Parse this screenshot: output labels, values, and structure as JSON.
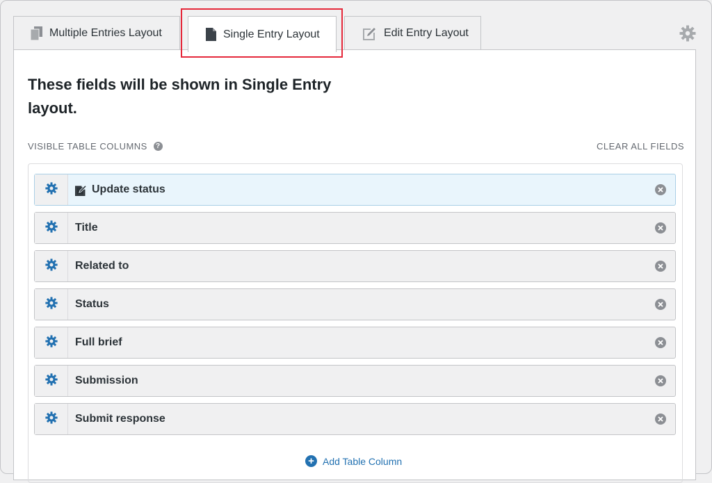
{
  "tabs": [
    {
      "label": "Multiple Entries Layout",
      "icon": "documents-icon"
    },
    {
      "label": "Single Entry Layout",
      "icon": "document-icon"
    },
    {
      "label": "Edit Entry Layout",
      "icon": "edit-document-icon"
    }
  ],
  "active_tab": "Single Entry Layout",
  "heading": "These fields will be shown in Single Entry layout.",
  "section": {
    "label": "VISIBLE TABLE COLUMNS",
    "help_icon": "?",
    "clear_all": "CLEAR ALL FIELDS"
  },
  "fields": [
    {
      "label": "Update status",
      "icon": "edit-icon",
      "highlighted": true
    },
    {
      "label": "Title"
    },
    {
      "label": "Related to"
    },
    {
      "label": "Status"
    },
    {
      "label": "Full brief"
    },
    {
      "label": "Submission"
    },
    {
      "label": "Submit response"
    }
  ],
  "add_column": {
    "label": "Add Table Column",
    "icon": "plus-circle-icon"
  },
  "colors": {
    "accent": "#2271b1",
    "highlight_border": "#e5283a",
    "active_row_bg": "#e9f5fc"
  }
}
